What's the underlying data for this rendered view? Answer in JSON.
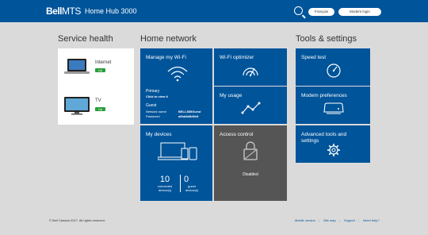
{
  "header": {
    "logo_bell": "Bell",
    "logo_mts": "MTS",
    "title": "Home Hub 3000",
    "language_label": "Français",
    "login_label": "Modem login"
  },
  "service_health": {
    "title": "Service health",
    "items": [
      {
        "label": "Internet",
        "status": "Up"
      },
      {
        "label": "TV",
        "status": "Up"
      }
    ]
  },
  "home_network": {
    "title": "Home network",
    "manage_wifi": {
      "title": "Manage my Wi-Fi",
      "primary_label": "Primary",
      "primary_action": "Click to view it",
      "guest_label": "Guest",
      "network_name_label": "Network name",
      "network_name_value": "BELL585Guest",
      "password_label": "Password",
      "password_value": "a6bd8d8d5e8"
    },
    "wifi_optimizer": {
      "title": "Wi-Fi optimizer"
    },
    "my_usage": {
      "title": "My usage"
    },
    "my_devices": {
      "title": "My devices",
      "connected_count": "10",
      "connected_label_1": "connected",
      "connected_label_2": "device(s)",
      "guest_count": "0",
      "guest_label_1": "guest",
      "guest_label_2": "device(s)"
    },
    "access_control": {
      "title": "Access control",
      "status": "Disabled"
    }
  },
  "tools": {
    "title": "Tools & settings",
    "speed_test": "Speed test",
    "modem_prefs": "Modem preferences",
    "advanced_1": "Advanced tools and",
    "advanced_2": "settings"
  },
  "footer": {
    "copyright": "© Bell Canada 2017. All rights reserved.",
    "links": [
      "Mobile version",
      "Site map",
      "Support",
      "Need help?"
    ]
  },
  "colors": {
    "brand": "#00549a",
    "status_up": "#2a9d3a",
    "tile_disabled": "#555555"
  }
}
